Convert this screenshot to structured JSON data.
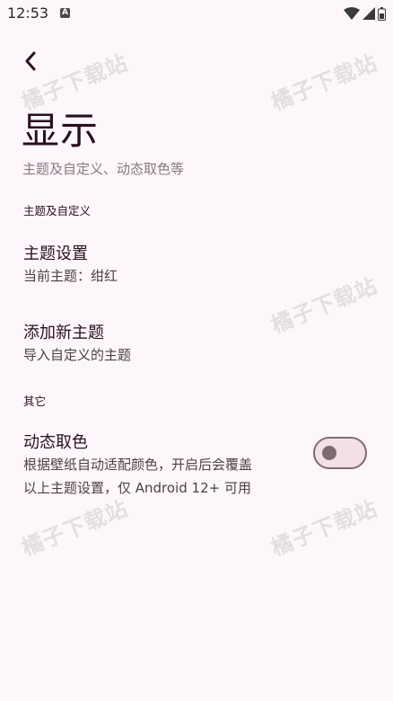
{
  "status_bar": {
    "time": "12:53",
    "notification_glyph": "A",
    "icons": [
      "wifi-icon",
      "cellular-signal-icon",
      "battery-icon"
    ]
  },
  "nav": {
    "back_icon": "back-arrow-icon"
  },
  "header": {
    "title": "显示",
    "subtitle": "主题及自定义、动态取色等"
  },
  "sections": [
    {
      "header": "主题及自定义",
      "items": [
        {
          "title": "主题设置",
          "summary": "当前主题：绀红"
        },
        {
          "title": "添加新主题",
          "summary": "导入自定义的主题"
        }
      ]
    },
    {
      "header": "其它",
      "items": [
        {
          "title": "动态取色",
          "summary_line1": "根据壁纸自动适配颜色，开启后会覆盖",
          "summary_line2": "以上主题设置，仅 Android 12+ 可用",
          "toggle_on": false
        }
      ]
    }
  ],
  "watermark": "橘子下载站",
  "colors": {
    "background": "#fdf7fb",
    "title_text": "#2a0f1c",
    "subtitle_text": "#8a7880",
    "toggle_track": "#f3dfe6",
    "toggle_outline": "#7d6b73"
  }
}
